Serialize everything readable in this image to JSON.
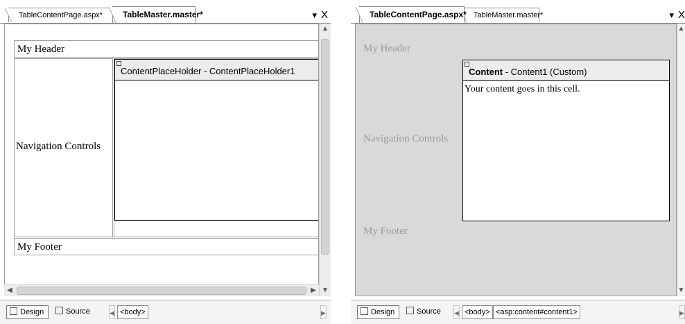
{
  "left": {
    "tabs": [
      "TableContentPage.aspx*",
      "TableMaster.master*"
    ],
    "header_text": "My Header",
    "nav_text": "Navigation Controls",
    "footer_text": "My Footer",
    "placeholder_label": "ContentPlaceHolder - ContentPlaceHolder1",
    "design_label": "Design",
    "source_label": "Source",
    "crumb": "<body>"
  },
  "right": {
    "tabs": [
      "TableContentPage.aspx*",
      "TableMaster.master*"
    ],
    "header_text": "My Header",
    "nav_text": "Navigation Controls",
    "footer_text": "My Footer",
    "content_title": "Content",
    "content_sub": " - Content1 (Custom)",
    "content_body": "Your content goes in this cell.",
    "design_label": "Design",
    "source_label": "Source",
    "crumbs": [
      "<body>",
      "<asp:content#content1>"
    ]
  },
  "window": {
    "pin_glyph": "▾",
    "close_glyph": "X"
  },
  "icons": [
    "scroll-up-icon",
    "scroll-down-icon",
    "scroll-left-icon",
    "scroll-right-icon",
    "close-icon",
    "pin-icon",
    "design-view-icon",
    "source-view-icon"
  ]
}
